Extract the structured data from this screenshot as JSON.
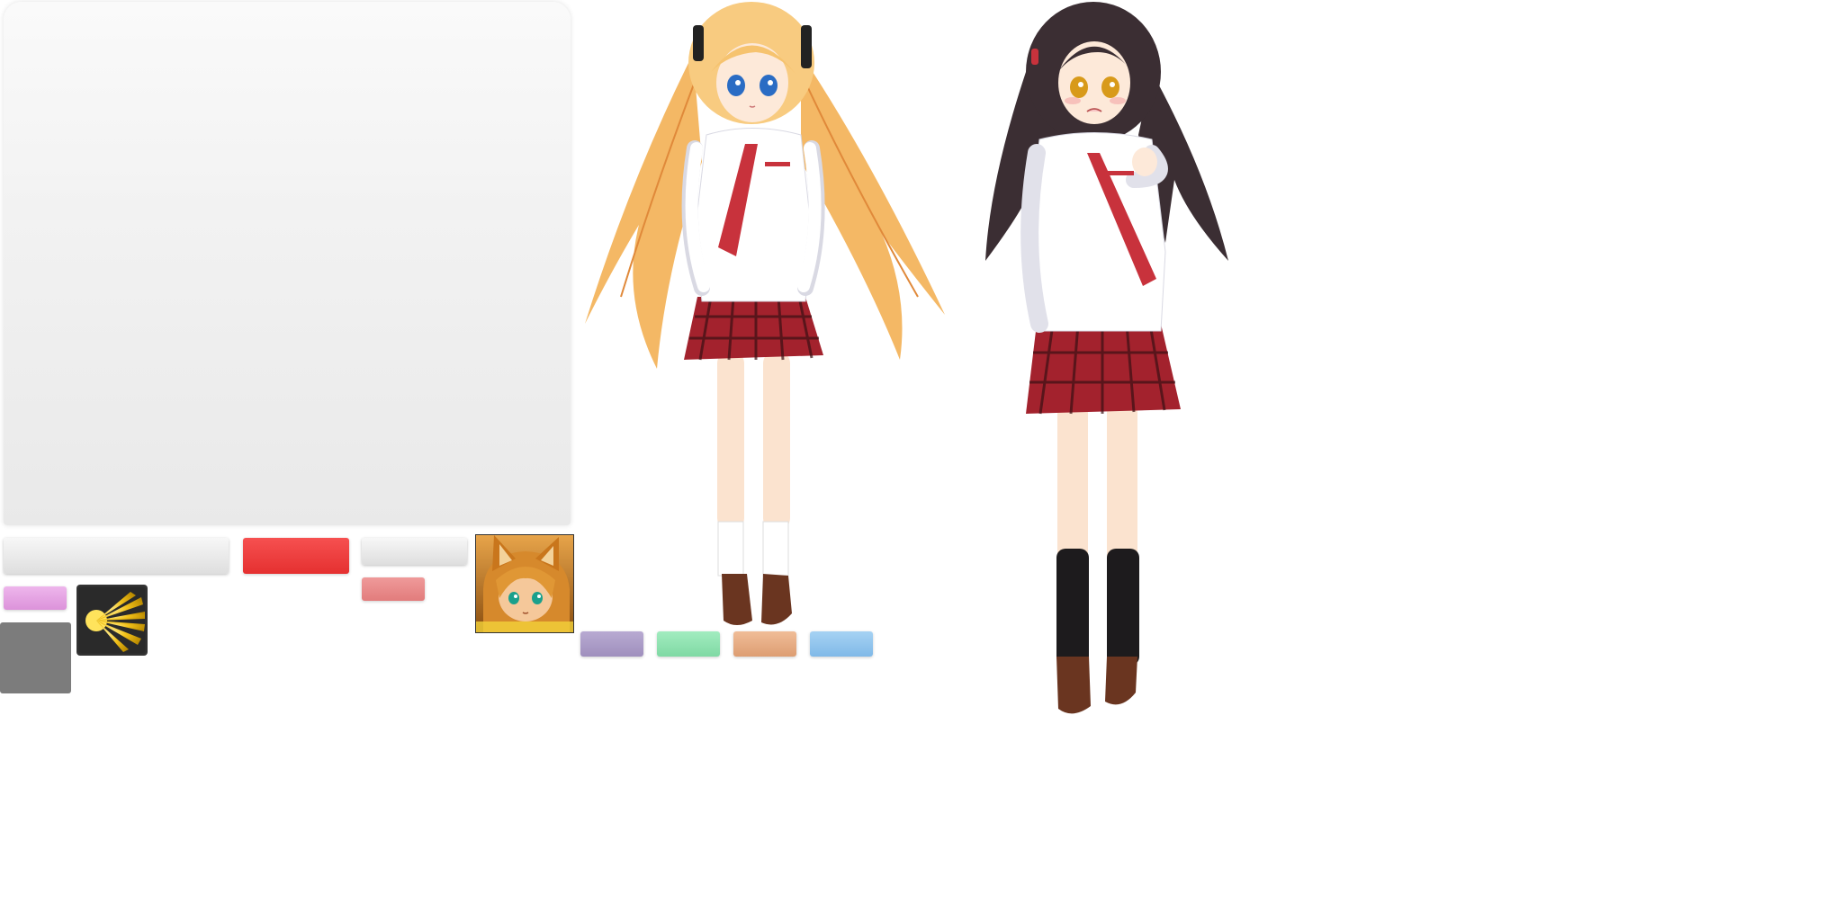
{
  "colors": {
    "panel": "#eeeeee",
    "button_red": "#f03a3a",
    "button_red_pale": "#e98888",
    "pill_pink": "#e6a4e4",
    "pill_purple": "#ad9dc8",
    "pill_green": "#8fe3b1",
    "pill_orange": "#e8ae85",
    "pill_blue": "#92c6ee",
    "grey_tile": "#7c7c7c",
    "icon_bg": "#2a2a2a",
    "skirt_plaid": "#a3222d",
    "tie": "#c8323c",
    "blonde_hair": "#f6c36f",
    "dark_hair": "#3b2e33"
  },
  "sprites": {
    "panel": "window-panel",
    "light_icon": "light-burst-icon",
    "fox_portrait": "fox-girl-portrait",
    "blonde_character": "blonde-twintail-schoolgirl",
    "dark_character": "dark-haired-schoolgirl"
  }
}
